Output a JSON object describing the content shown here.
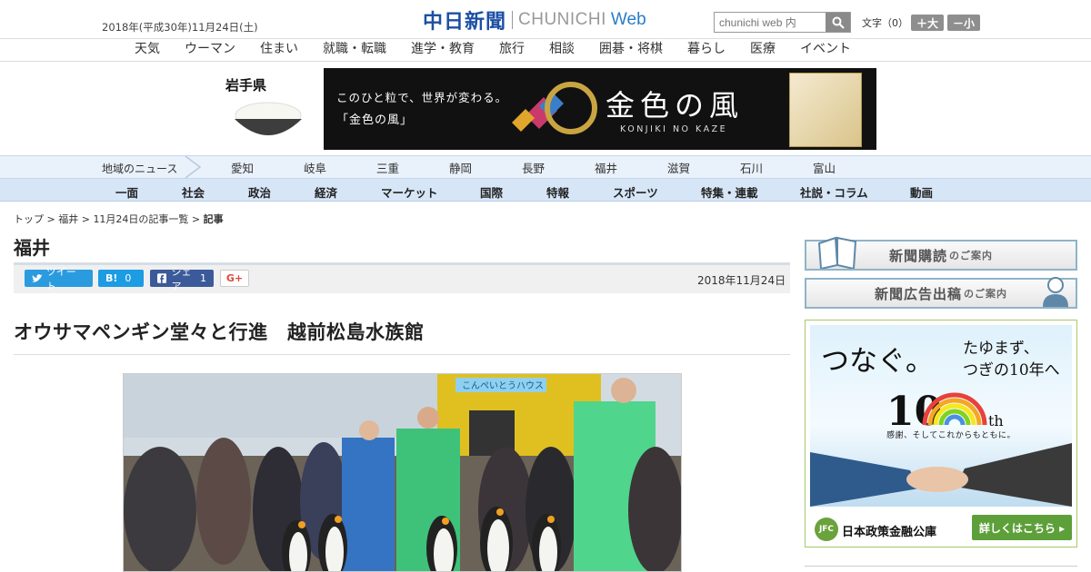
{
  "header": {
    "date": "2018年(平成30年)11月24日(土)",
    "logo_main": "中日新聞",
    "logo_en": "CHUNICHI",
    "logo_web": "Web",
    "search_placeholder": "chunichi web 内",
    "font_size_label": "文字（0）",
    "font_larger": "＋大",
    "font_smaller": "－小"
  },
  "top_nav": [
    "天気",
    "ウーマン",
    "住まい",
    "就職・転職",
    "進学・教育",
    "旅行",
    "相談",
    "囲碁・将棋",
    "暮らし",
    "医療",
    "イベント"
  ],
  "banner": {
    "prefecture": "岩手県",
    "copy1": "このひと粒で、世界が変わる。",
    "copy2": "「金色の風」",
    "title": "金色の風",
    "subtitle": "KONJIKI NO KAZE"
  },
  "region_nav": {
    "label": "地域のニュース",
    "items": [
      "愛知",
      "岐阜",
      "三重",
      "静岡",
      "長野",
      "福井",
      "滋賀",
      "石川",
      "富山"
    ]
  },
  "category_nav": [
    "一面",
    "社会",
    "政治",
    "経済",
    "マーケット",
    "国際",
    "特報",
    "スポーツ",
    "特集・連載",
    "社説・コラム",
    "動画"
  ],
  "breadcrumb": {
    "top": "トップ",
    "pref": "福井",
    "list": "11月24日の記事一覧",
    "current": "記事",
    "sep": " > "
  },
  "section_title": "福井",
  "share": {
    "tweet": "ツイート",
    "hatena": "B!",
    "hatena_count": "0",
    "facebook": "シェア",
    "facebook_count": "1",
    "gplus": "G+"
  },
  "article": {
    "date": "2018年11月24日",
    "headline": "オウサマペンギン堂々と行進　越前松島水族館",
    "photo_sign": "こんぺいとうハウス"
  },
  "sidebar": {
    "subscribe": "新聞購読",
    "subscribe_suffix": "のご案内",
    "advertise": "新聞広告出稿",
    "advertise_suffix": "のご案内"
  },
  "ad": {
    "t1": "つなぐ。",
    "t2a": "たゆまず、",
    "t2b": "つぎの10年へ",
    "ten": "10",
    "th": "th",
    "tagline": "感謝、そしてこれからもともに。",
    "jfc_logo": "JFC",
    "jfc_name": "日本政策金融公庫",
    "more": "詳しくはこちら ▸"
  },
  "colors": {
    "brand_blue": "#1c4fa3",
    "region_bg": "#e9f1fb",
    "category_bg": "#d7e6f7",
    "ad_green": "#5da03a"
  }
}
